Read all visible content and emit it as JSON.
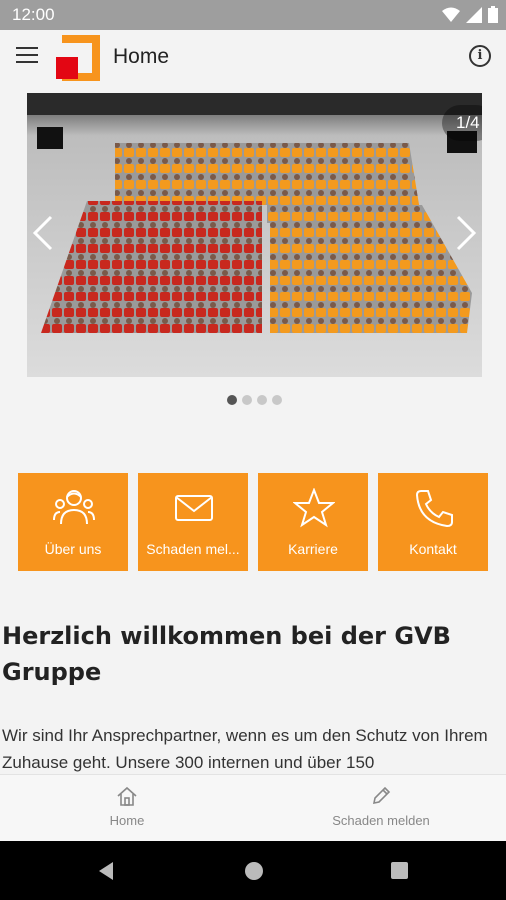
{
  "status_bar": {
    "time": "12:00"
  },
  "app_bar": {
    "title": "Home"
  },
  "carousel": {
    "counter": "1/4",
    "slide_count": 4,
    "active_index": 0
  },
  "tiles": [
    {
      "label": "Über uns",
      "icon": "team-icon"
    },
    {
      "label": "Schaden mel...",
      "icon": "mail-icon"
    },
    {
      "label": "Karriere",
      "icon": "star-icon"
    },
    {
      "label": "Kontakt",
      "icon": "phone-icon"
    }
  ],
  "content": {
    "heading": "Herzlich willkommen bei der GVB Gruppe",
    "intro": "Wir sind Ihr Ansprechpartner, wenn es um den Schutz von Ihrem Zuhause geht. Unsere 300 internen und über 150"
  },
  "bottom_nav": [
    {
      "label": "Home",
      "icon": "home-icon"
    },
    {
      "label": "Schaden melden",
      "icon": "pencil-icon"
    }
  ],
  "colors": {
    "accent": "#f7941d",
    "logo_red": "#e30613"
  }
}
